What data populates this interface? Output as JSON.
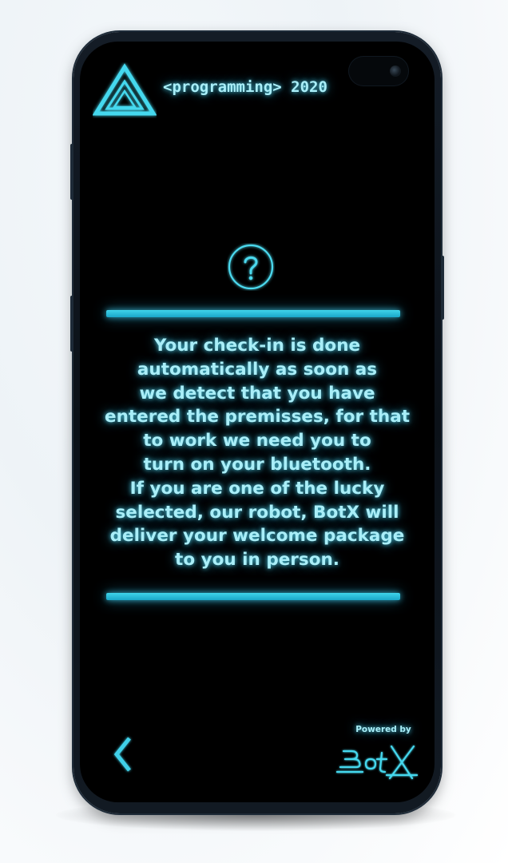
{
  "header": {
    "title": "<programming> 2020",
    "logo_icon": "triangle-logo-icon"
  },
  "help": {
    "icon": "question-mark-icon"
  },
  "message": {
    "lines": [
      "Your check-in is done",
      "automatically as soon as",
      "we detect that you have",
      "entered the premisses, for that",
      "to work we need you to",
      "turn on your bluetooth.",
      "If you are one of the lucky",
      "selected, our robot, BotX will",
      "deliver your welcome package",
      "to you in person."
    ]
  },
  "footer": {
    "back_icon": "chevron-left-icon",
    "powered_by": "Powered by",
    "brand_logo": "botx-logo"
  },
  "colors": {
    "accent": "#3fd4ea",
    "text": "#a9eef8",
    "background": "#000000"
  }
}
